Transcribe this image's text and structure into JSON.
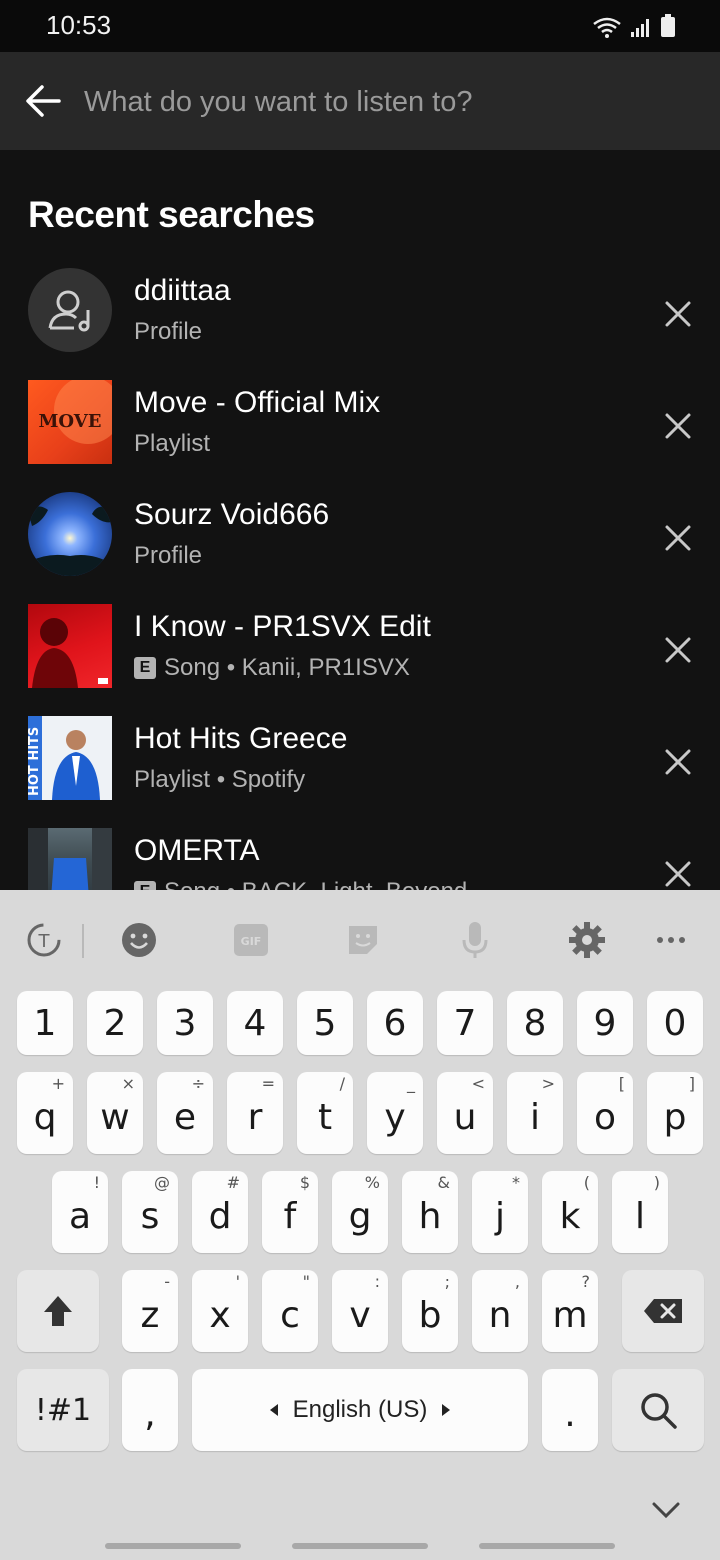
{
  "status": {
    "time": "10:53"
  },
  "search": {
    "placeholder": "What do you want to listen to?"
  },
  "recent": {
    "title": "Recent searches",
    "items": [
      {
        "title": "ddiittaa",
        "subtitle": "Profile",
        "explicit": false,
        "thumb": "profile-placeholder"
      },
      {
        "title": "Move - Official Mix",
        "subtitle": "Playlist",
        "explicit": false,
        "thumb": "move-cover",
        "cover_text": "MOVE"
      },
      {
        "title": "Sourz Void666",
        "subtitle": "Profile",
        "explicit": false,
        "thumb": "sky-photo"
      },
      {
        "title": "I Know - PR1SVX Edit",
        "subtitle": "Song • Kanii, PR1ISVX",
        "explicit": true,
        "thumb": "red-cover"
      },
      {
        "title": "Hot Hits Greece",
        "subtitle": "Playlist • Spotify",
        "explicit": false,
        "thumb": "hot-hits-cover",
        "cover_text": "HOT HITS"
      },
      {
        "title": "OMERTA",
        "subtitle": "Song • BACK, Light, Beyond",
        "explicit": true,
        "thumb": "omerta-cover"
      }
    ]
  },
  "keyboard": {
    "numbers": [
      "1",
      "2",
      "3",
      "4",
      "5",
      "6",
      "7",
      "8",
      "9",
      "0"
    ],
    "row1": [
      {
        "k": "q",
        "h": "+"
      },
      {
        "k": "w",
        "h": "×"
      },
      {
        "k": "e",
        "h": "÷"
      },
      {
        "k": "r",
        "h": "="
      },
      {
        "k": "t",
        "h": "/"
      },
      {
        "k": "y",
        "h": "_"
      },
      {
        "k": "u",
        "h": "<"
      },
      {
        "k": "i",
        "h": ">"
      },
      {
        "k": "o",
        "h": "["
      },
      {
        "k": "p",
        "h": "]"
      }
    ],
    "row2": [
      {
        "k": "a",
        "h": "!"
      },
      {
        "k": "s",
        "h": "@"
      },
      {
        "k": "d",
        "h": "#"
      },
      {
        "k": "f",
        "h": "$"
      },
      {
        "k": "g",
        "h": "%"
      },
      {
        "k": "h",
        "h": "&"
      },
      {
        "k": "j",
        "h": "*"
      },
      {
        "k": "k",
        "h": "("
      },
      {
        "k": "l",
        "h": ")"
      }
    ],
    "row3": [
      {
        "k": "z",
        "h": "-"
      },
      {
        "k": "x",
        "h": "'"
      },
      {
        "k": "c",
        "h": "\""
      },
      {
        "k": "v",
        "h": ":"
      },
      {
        "k": "b",
        "h": ";"
      },
      {
        "k": "n",
        "h": ","
      },
      {
        "k": "m",
        "h": "?"
      }
    ],
    "symbols_label": "!#1",
    "comma": ",",
    "language": "English (US)",
    "period": "."
  }
}
